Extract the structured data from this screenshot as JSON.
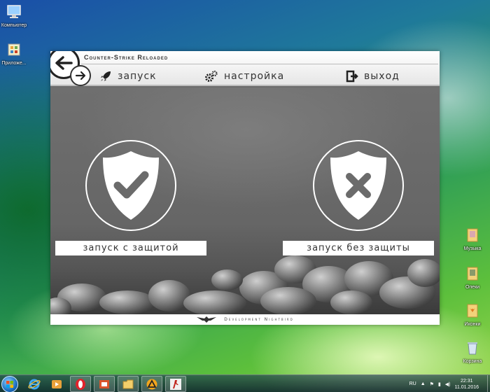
{
  "desktop": {
    "left_icons": [
      {
        "label": "Компьютер",
        "icon": "computer-icon"
      },
      {
        "label": "Приложе...",
        "icon": "app-icon"
      }
    ],
    "right_icons": [
      {
        "label": "Музыка",
        "icon": "music-folder-icon"
      },
      {
        "label": "Опеки",
        "icon": "folder-icon"
      },
      {
        "label": "Иконки",
        "icon": "fox-folder-icon"
      },
      {
        "label": "Корзина",
        "icon": "recycle-bin-icon"
      }
    ]
  },
  "app": {
    "title": "Counter-Strike Reloaded",
    "nav": {
      "launch": "запуск",
      "settings": "настройка",
      "exit": "выход"
    },
    "options": {
      "protected": "запуск с защитой",
      "unprotected": "запуск без защиты"
    },
    "footer": "Development Nightbird"
  },
  "taskbar": {
    "apps": [
      "internet-explorer-icon",
      "media-player-icon",
      "opera-icon",
      "office-icon",
      "explorer-icon",
      "triangle-app-icon",
      "counter-strike-icon"
    ],
    "language": "RU",
    "time": "22:31",
    "date": "11.01.2016"
  },
  "colors": {
    "window_bg": "#6b6b6b",
    "bar_bg": "#ffffff",
    "text": "#333333",
    "taskbar": "#1b3b50"
  }
}
